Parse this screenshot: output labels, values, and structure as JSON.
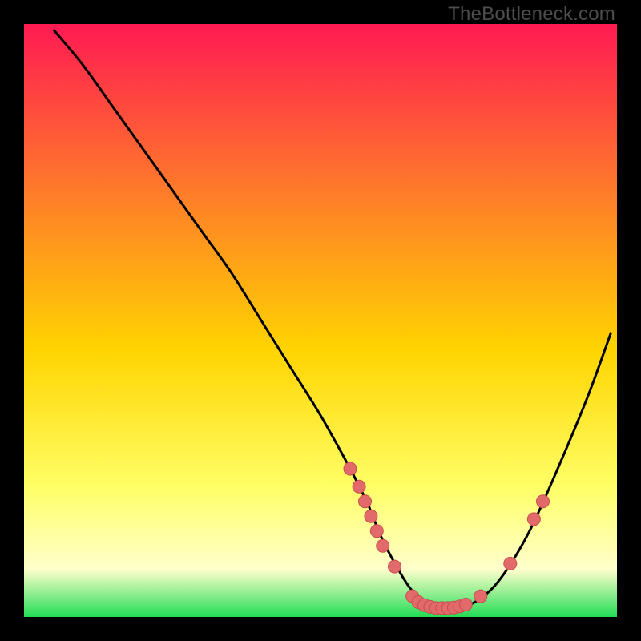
{
  "watermark": "TheBottleneck.com",
  "colors": {
    "gradient_top": "#ff1a52",
    "gradient_upper_mid": "#ff7a2a",
    "gradient_mid": "#ffd400",
    "gradient_lower_mid": "#ffff66",
    "gradient_glow": "#ffffcc",
    "gradient_bottom": "#22dd55",
    "curve": "#000000",
    "marker_fill": "#e26a6a",
    "marker_stroke": "#c94f4f"
  },
  "chart_data": {
    "type": "line",
    "title": "",
    "xlabel": "",
    "ylabel": "",
    "xlim": [
      0,
      100
    ],
    "ylim": [
      0,
      100
    ],
    "curve": {
      "name": "bottleneck-curve",
      "x": [
        5,
        10,
        15,
        20,
        25,
        30,
        35,
        40,
        45,
        50,
        55,
        58,
        60,
        62,
        65,
        68,
        70,
        73,
        76,
        80,
        85,
        90,
        95,
        99
      ],
      "y": [
        99,
        93,
        86,
        79,
        72,
        65,
        58,
        50,
        42,
        34,
        25,
        19,
        14,
        10,
        5,
        2,
        1.5,
        1.5,
        2.5,
        6,
        14,
        25,
        37,
        48
      ]
    },
    "markers": [
      {
        "x": 55.0,
        "y": 25.0
      },
      {
        "x": 56.5,
        "y": 22.0
      },
      {
        "x": 57.5,
        "y": 19.5
      },
      {
        "x": 58.5,
        "y": 17.0
      },
      {
        "x": 59.5,
        "y": 14.5
      },
      {
        "x": 60.5,
        "y": 12.0
      },
      {
        "x": 62.5,
        "y": 8.5
      },
      {
        "x": 65.5,
        "y": 3.5
      },
      {
        "x": 66.5,
        "y": 2.5
      },
      {
        "x": 67.5,
        "y": 2.0
      },
      {
        "x": 68.5,
        "y": 1.7
      },
      {
        "x": 69.5,
        "y": 1.5
      },
      {
        "x": 70.5,
        "y": 1.5
      },
      {
        "x": 71.5,
        "y": 1.5
      },
      {
        "x": 72.5,
        "y": 1.6
      },
      {
        "x": 73.5,
        "y": 1.8
      },
      {
        "x": 74.5,
        "y": 2.1
      },
      {
        "x": 77.0,
        "y": 3.5
      },
      {
        "x": 82.0,
        "y": 9.0
      },
      {
        "x": 86.0,
        "y": 16.5
      },
      {
        "x": 87.5,
        "y": 19.5
      }
    ]
  }
}
